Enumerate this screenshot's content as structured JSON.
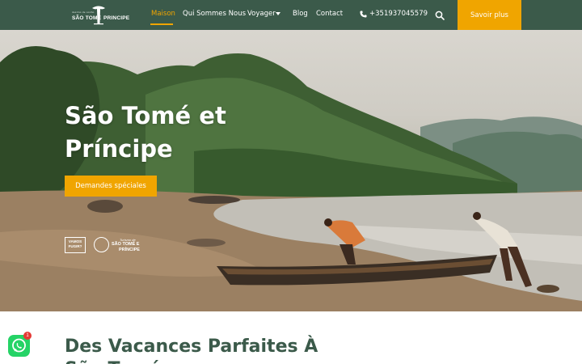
{
  "header": {
    "logo": {
      "tagline": "destino de sonho",
      "word1": "SÃO TOMÉ",
      "word2": "PRINCIPE"
    },
    "nav": [
      {
        "label": "Maison",
        "active": true
      },
      {
        "label": "Qui Sommes Nous",
        "active": false
      },
      {
        "label": "Voyager",
        "active": false,
        "has_dropdown": true
      },
      {
        "label": "Blog",
        "active": false
      },
      {
        "label": "Contact",
        "active": false
      }
    ],
    "phone": "+351937045579",
    "cta_label": "Savoir plus"
  },
  "hero": {
    "title": "São Tomé et Príncipe",
    "button_label": "Demandes spéciales",
    "partners": {
      "logo1": "VAMOS FUGIR?",
      "logo2_line1": "Turismo de",
      "logo2_line2": "SÃO TOMÉ E",
      "logo2_line3": "PRÍNCIPE"
    }
  },
  "intro": {
    "heading": "Des Vacances Parfaites À São Tomé"
  },
  "whatsapp": {
    "badge_count": "1"
  },
  "colors": {
    "header_bg": "#3b5a4a",
    "accent": "#f0a500",
    "heading": "#3b5a4a",
    "whatsapp": "#25d366"
  }
}
